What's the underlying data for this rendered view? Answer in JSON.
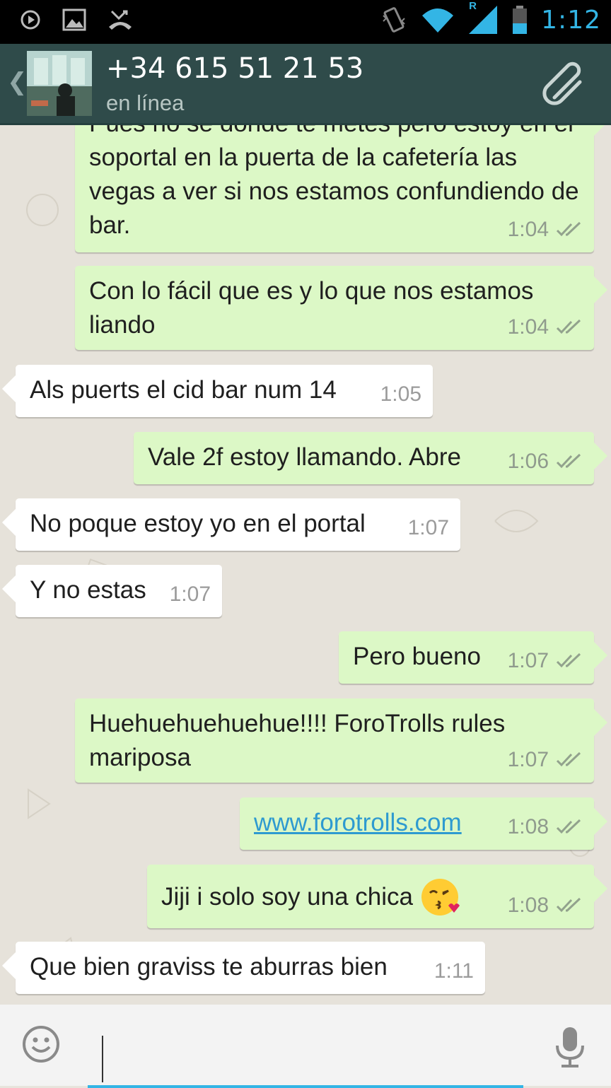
{
  "status_bar": {
    "time": "1:12",
    "icons": [
      "play-icon",
      "image-icon",
      "missed-call-icon",
      "vibrate-icon",
      "wifi-icon",
      "signal-icon",
      "battery-icon"
    ],
    "signal_roaming": "R"
  },
  "header": {
    "contact": "+34 615 51 21 53",
    "status": "en línea",
    "back_icon": "chevron-left-icon",
    "attach_icon": "paperclip-icon"
  },
  "messages": [
    {
      "dir": "out",
      "text": "Pues no se donde te metes pero estoy en el soportal en la puerta de la cafetería las vegas a ver si nos estamos confundiendo de bar.",
      "time": "1:04"
    },
    {
      "dir": "out",
      "text": "Con lo fácil que es y lo que nos estamos liando",
      "time": "1:04"
    },
    {
      "dir": "in",
      "text": "Als puerts el cid bar num 14",
      "time": "1:05"
    },
    {
      "dir": "out",
      "text": "Vale 2f estoy llamando. Abre",
      "time": "1:06"
    },
    {
      "dir": "in",
      "text": "No poque estoy yo en el portal",
      "time": "1:07"
    },
    {
      "dir": "in",
      "text": "Y no estas",
      "time": "1:07"
    },
    {
      "dir": "out",
      "text": "Pero bueno",
      "time": "1:07"
    },
    {
      "dir": "out",
      "text": "Huehuehuehuehue!!!! ForoTrolls rules mariposa",
      "time": "1:07"
    },
    {
      "dir": "out",
      "text": "www.forotrolls.com",
      "time": "1:08"
    },
    {
      "dir": "out",
      "text": "Jiji i solo soy una chica",
      "time": "1:08",
      "emoji": "kissing-face-emoji"
    },
    {
      "dir": "in",
      "text": "Que bien graviss te aburras bien",
      "time": "1:11"
    }
  ],
  "composer": {
    "value": "",
    "placeholder": "",
    "emoji_icon": "smiley-icon",
    "mic_icon": "microphone-icon"
  },
  "colors": {
    "header": "#2f4b4a",
    "outgoing": "#dcf8c6",
    "incoming": "#ffffff",
    "accent": "#33b5e5",
    "status_time": "#33b5e5"
  }
}
